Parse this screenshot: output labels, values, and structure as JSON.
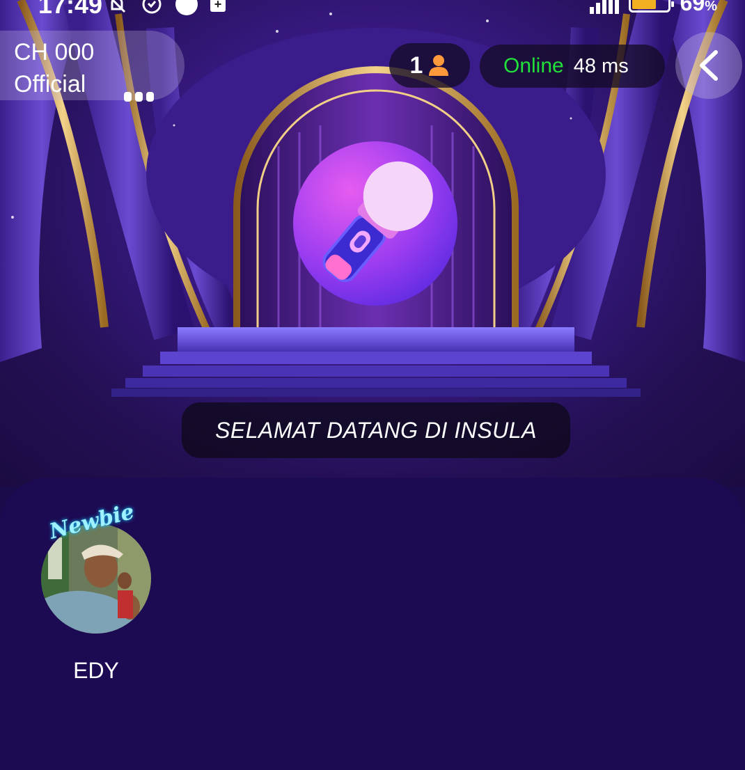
{
  "status_bar": {
    "time": "17:49",
    "battery": "69",
    "battery_unit": "%",
    "battery_level": 0.69,
    "icons": [
      "bell-off-icon",
      "clock-icon",
      "dot-icon",
      "plus-box-icon",
      "signal-icon",
      "battery-icon"
    ]
  },
  "room": {
    "name": "CH 000 Official",
    "more_icon": "more-dots-icon"
  },
  "audience": {
    "count": "1",
    "icon": "person-icon"
  },
  "connection": {
    "status": "Online",
    "ping": "48 ms",
    "status_color": "#22e03a"
  },
  "navigation": {
    "back_icon": "chevron-left-icon"
  },
  "stage": {
    "icon": "microphone-icon",
    "accent": "#c940f0"
  },
  "banner": {
    "text": "SELAMAT DATANG DI INSULA"
  },
  "seats": [
    {
      "name": "EDY",
      "badge": "Newbie"
    }
  ]
}
